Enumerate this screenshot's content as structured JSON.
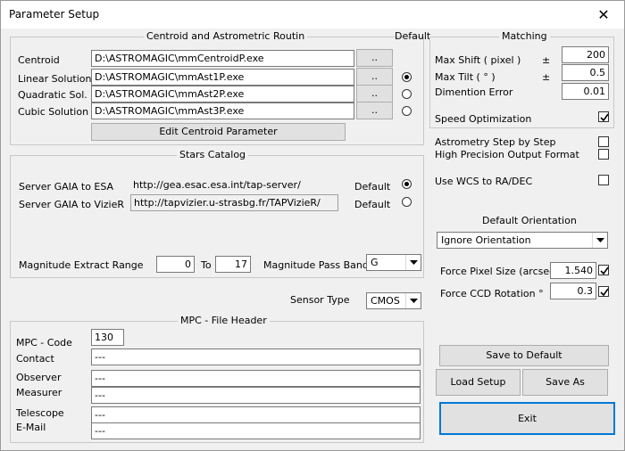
{
  "window": {
    "title": "Parameter Setup",
    "close": "✕"
  },
  "centroid": {
    "frame_title": "Centroid and Astrometric Routin",
    "default_label": "Default",
    "rows": [
      {
        "label": "Centroid",
        "path": "D:\\ASTROMAGIC\\mmCentroidP.exe",
        "browse": ".."
      },
      {
        "label": "Linear Solution",
        "path": "D:\\ASTROMAGIC\\mmAst1P.exe",
        "browse": "..",
        "selected": true
      },
      {
        "label": "Quadratic Sol.",
        "path": "D:\\ASTROMAGIC\\mmAst2P.exe",
        "browse": "..",
        "selected": false
      },
      {
        "label": "Cubic Solution",
        "path": "D:\\ASTROMAGIC\\mmAst3P.exe",
        "browse": "..",
        "selected": false
      }
    ],
    "edit_button": "Edit Centroid  Parameter"
  },
  "matching": {
    "frame_title": "Matching",
    "max_shift_label": "Max Shift ( pixel )",
    "max_shift_pm": "±",
    "max_shift_value": "200",
    "max_tilt_label": "Max Tilt ( ° )",
    "max_tilt_pm": "±",
    "max_tilt_value": "0.5",
    "dimention_error_label": "Dimention Error",
    "dimention_error_value": "0.01",
    "speed_opt_label": "Speed Optimization",
    "speed_opt_checked": true
  },
  "stars": {
    "frame_title": "Stars  Catalog",
    "esa_label": "Server GAIA  to  ESA",
    "esa_url": "http://gea.esac.esa.int/tap-server/",
    "esa_default": "Default",
    "esa_selected": true,
    "vizier_label": "Server GAIA  to VizieR",
    "vizier_url": "http://tapvizier.u-strasbg.fr/TAPVizieR/",
    "vizier_default": "Default",
    "vizier_selected": false,
    "mag_range_label": "Magnitude Extract Range",
    "mag_from": "0",
    "mag_to_label": "To",
    "mag_to": "17",
    "pass_band_label": "Magnitude Pass Band",
    "pass_band_value": "G"
  },
  "options": {
    "astrometry_step": "Astrometry Step by Step",
    "astrometry_step_checked": false,
    "high_precision": "High Precision Output Format",
    "high_precision_checked": false,
    "use_wcs": "Use WCS  to  RA/DEC",
    "use_wcs_checked": false
  },
  "orientation": {
    "title": "Default Orientation",
    "value": "Ignore Orientation",
    "pixel_size_label": "Force Pixel Size (arcsec)",
    "pixel_size_value": "1.540",
    "pixel_size_checked": true,
    "ccd_rotation_label": "Force CCD Rotation °",
    "ccd_rotation_value": "0.3",
    "ccd_rotation_checked": true
  },
  "sensor": {
    "label": "Sensor Type",
    "value": "CMOS"
  },
  "mpc": {
    "frame_title": "MPC - File Header",
    "code_label": "MPC - Code",
    "code_value": "130",
    "contact_label": "Contact",
    "contact_value": "---",
    "observer_label": "Observer",
    "observer_value": "---",
    "measurer_label": "Measurer",
    "measurer_value": "---",
    "telescope_label": "Telescope",
    "telescope_value": "---",
    "email_label": "E-Mail",
    "email_value": "---"
  },
  "buttons": {
    "save_default": "Save to Default",
    "load_setup": "Load  Setup",
    "save_as": "Save As",
    "exit": "Exit"
  }
}
